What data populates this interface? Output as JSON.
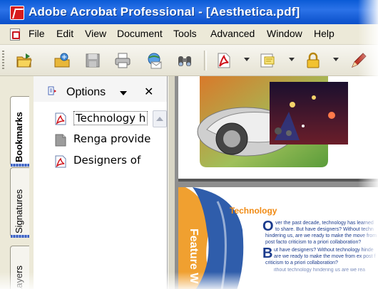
{
  "window": {
    "title": "Adobe Acrobat Professional - [Aesthetica.pdf]"
  },
  "menu": {
    "items": [
      {
        "label": "File"
      },
      {
        "label": "Edit"
      },
      {
        "label": "View"
      },
      {
        "label": "Document"
      },
      {
        "label": "Tools"
      },
      {
        "label": "Advanced"
      },
      {
        "label": "Window"
      },
      {
        "label": "Help"
      }
    ]
  },
  "toolbar": {
    "buttons": [
      {
        "icon": "open-folder-icon"
      },
      {
        "icon": "organizer-icon"
      },
      {
        "icon": "save-icon"
      },
      {
        "icon": "print-icon"
      },
      {
        "icon": "email-icon"
      },
      {
        "icon": "search-binoculars-icon"
      },
      {
        "icon": "create-pdf-icon"
      },
      {
        "icon": "comment-icon"
      },
      {
        "icon": "secure-lock-icon"
      },
      {
        "icon": "sign-pen-icon"
      }
    ]
  },
  "nav_tabs": [
    {
      "label": "Bookmarks",
      "active": true
    },
    {
      "label": "Signatures",
      "active": false
    },
    {
      "label": "Layers",
      "active": false
    }
  ],
  "bookmarks_panel": {
    "options_label": "Options",
    "close_glyph": "✕",
    "items": [
      {
        "label": "Technology h",
        "selected": true,
        "icon": "pdf-bookmark-icon"
      },
      {
        "label": "Renga provide",
        "selected": false,
        "icon": "page-bookmark-icon"
      },
      {
        "label": "Designers of",
        "selected": false,
        "icon": "pdf-bookmark-icon"
      }
    ]
  },
  "document": {
    "page2_heading": "Technology",
    "feature_label": "Feature W",
    "paragraphs": [
      "ver the past decade, technology has learned",
      "to share. But have designers? Without techn",
      "hindering us, are we ready to make the move from",
      "post facto criticism to a priori collaboration?",
      "ut have designers? Without technology hinde",
      "are we ready to make the move from ex post f",
      "criticism to a priori collaboration?",
      "ithout technology hindering us are we rea"
    ]
  },
  "colors": {
    "title_bar": "#0b5bd6",
    "chrome": "#ece9d8",
    "accent_orange": "#f08a13",
    "text_blue": "#1a3a8c"
  }
}
